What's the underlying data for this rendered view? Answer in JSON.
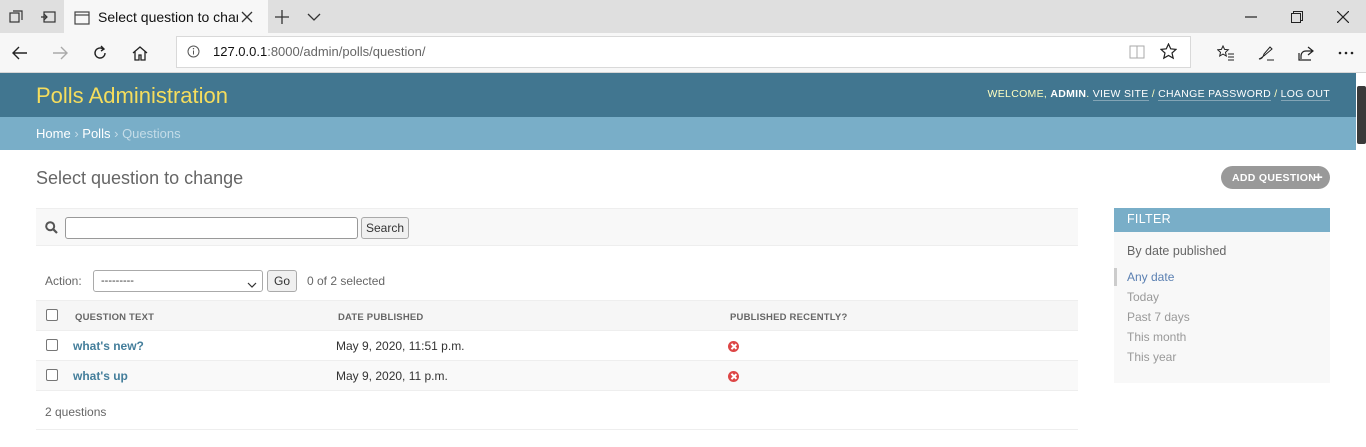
{
  "browser": {
    "tab_title": "Select question to change",
    "url_host": "127.0.0.1",
    "url_rest": ":8000/admin/polls/question/"
  },
  "header": {
    "branding": "Polls Administration",
    "welcome": "WELCOME,",
    "user": "ADMIN",
    "view_site": "VIEW SITE",
    "change_password": "CHANGE PASSWORD",
    "log_out": "LOG OUT",
    "separator": "/"
  },
  "breadcrumbs": {
    "home": "Home",
    "app": "Polls",
    "current": "Questions",
    "sep": "›"
  },
  "page": {
    "title": "Select question to change",
    "add_button": "ADD QUESTION"
  },
  "search": {
    "value": "",
    "button": "Search"
  },
  "actions": {
    "label": "Action:",
    "selected": "---------",
    "go": "Go",
    "count": "0 of 2 selected"
  },
  "table": {
    "headers": [
      "QUESTION TEXT",
      "DATE PUBLISHED",
      "PUBLISHED RECENTLY?"
    ],
    "rows": [
      {
        "question": "what's new?",
        "date": "May 9, 2020, 11:51 p.m.",
        "recent": "no"
      },
      {
        "question": "what's up",
        "date": "May 9, 2020, 11 p.m.",
        "recent": "no"
      }
    ],
    "footer": "2 questions"
  },
  "filter": {
    "heading": "FILTER",
    "title": "By date published",
    "items": [
      "Any date",
      "Today",
      "Past 7 days",
      "This month",
      "This year"
    ],
    "selected": "Any date"
  },
  "colors": {
    "header_bg": "#417690",
    "branding": "#f5dd5d",
    "breadcrumb_bg": "#79aec8",
    "link": "#447e9b",
    "false_icon": "#dd4646"
  }
}
